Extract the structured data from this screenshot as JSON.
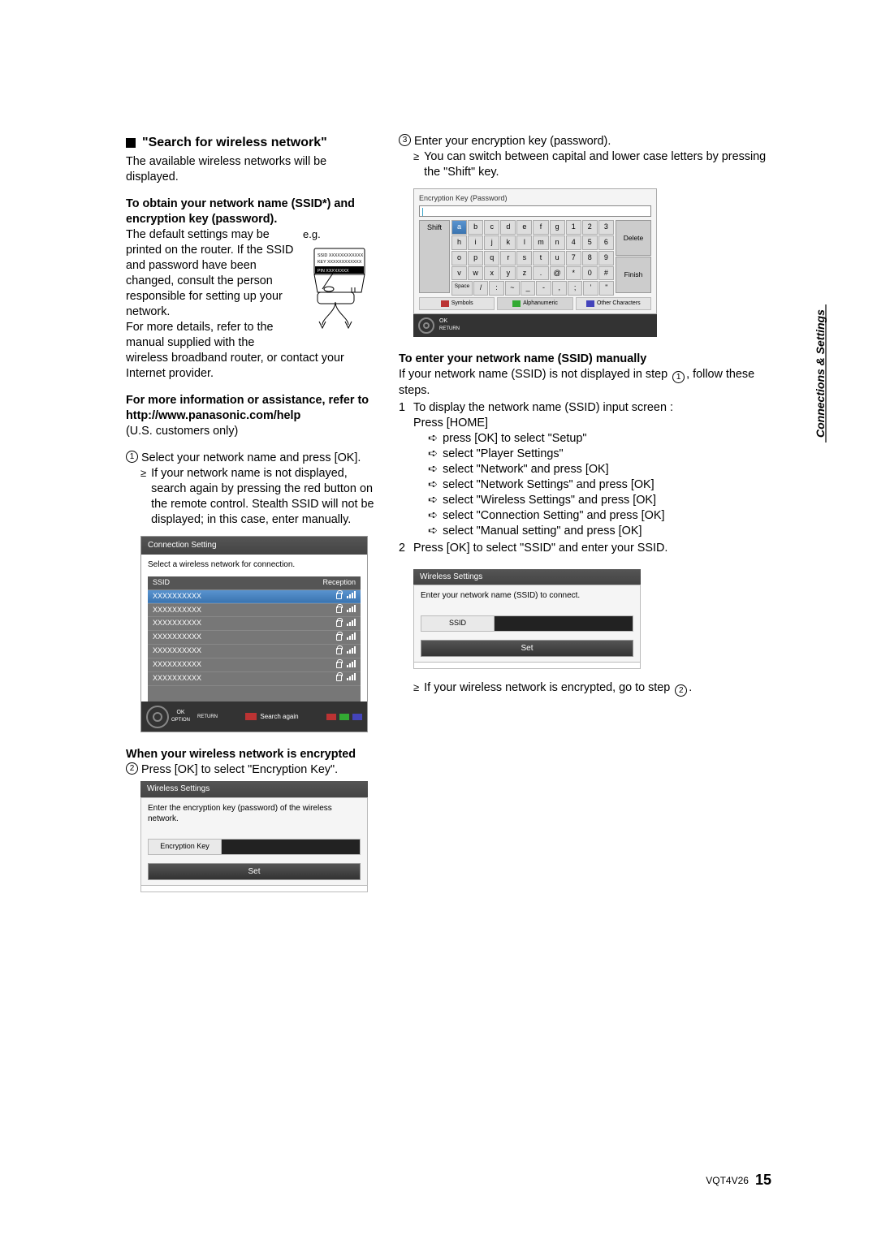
{
  "left": {
    "title": "\"Search for wireless network\"",
    "intro": "The available wireless networks will be displayed.",
    "obtainHdr": "To obtain your network name (SSID*) and encryption key (password).",
    "eg": "e.g.",
    "defaults": "The default settings may be printed on the router. If the SSID and password have been changed, consult the person responsible for setting up your network.",
    "moreDetails": "For more details, refer to the manual supplied with the wireless broadband router, or contact your Internet provider.",
    "moreInfo1": "For more information or assistance, refer to http://www.panasonic.com/help",
    "usOnly": "(U.S. customers only)",
    "step1": "Select your network name and press [OK].",
    "step1sub": "If your network name is not displayed, search again by pressing the red button on the remote control. Stealth SSID will not be displayed; in this case, enter manually.",
    "connSettingHdr": "Connection Setting",
    "connPrompt": "Select a wireless network for connection.",
    "ssidCol": "SSID",
    "recCol": "Reception",
    "ssidVal": "XXXXXXXXXX",
    "searchAgain": "Search again",
    "okLabel": "OK",
    "optionLabel": "OPTION",
    "returnLabel": "RETURN",
    "encryptHdr": "When your wireless network is encrypted",
    "step2": "Press [OK] to select \"Encryption Key\".",
    "wirelessHdr": "Wireless Settings",
    "enterKeyPrompt": "Enter the encryption key (password) of the wireless network.",
    "encKeyLabel": "Encryption Key",
    "setLabel": "Set"
  },
  "right": {
    "step3": "Enter your encryption key (password).",
    "step3sub": "You can switch between capital and lower case letters by pressing the \"Shift\" key.",
    "kbdTitle": "Encryption Key (Password)",
    "shift": "Shift",
    "del": "Delete",
    "finish": "Finish",
    "rows": [
      [
        "a",
        "b",
        "c",
        "d",
        "e",
        "f",
        "g",
        "1",
        "2",
        "3"
      ],
      [
        "h",
        "i",
        "j",
        "k",
        "l",
        "m",
        "n",
        "4",
        "5",
        "6"
      ],
      [
        "o",
        "p",
        "q",
        "r",
        "s",
        "t",
        "u",
        "7",
        "8",
        "9"
      ],
      [
        "v",
        "w",
        "x",
        "y",
        "z",
        ".",
        "@",
        "*",
        "0",
        "#"
      ]
    ],
    "specialRow": [
      "Space",
      "/",
      ":",
      "~",
      "_",
      "-",
      ",",
      ";",
      "’",
      "\""
    ],
    "tabSymbols": "Symbols",
    "tabAlpha": "Alphanumeric",
    "tabOther": "Other Characters",
    "okRet": "OK",
    "returnLabel": "RETURN",
    "manualHdr": "To enter your network name (SSID) manually",
    "manualIntro1": "If your network name (SSID) is not displayed in step ",
    "manualIntro2": ", follow these steps.",
    "m1": "To display the network name (SSID) input screen :",
    "pressHome": "Press [HOME]",
    "subs": [
      "press [OK] to select \"Setup\"",
      "select \"Player Settings\"",
      "select \"Network\" and press [OK]",
      "select \"Network Settings\" and press [OK]",
      "select \"Wireless Settings\" and press [OK]",
      "select \"Connection Setting\" and press [OK]",
      "select \"Manual setting\" and press [OK]"
    ],
    "m2": "Press [OK] to select \"SSID\" and enter your SSID.",
    "wirelessHdr": "Wireless Settings",
    "ssidPrompt": "Enter your network name (SSID) to connect.",
    "ssidLabel": "SSID",
    "setLabel": "Set",
    "encrNote1": "If your wireless network is encrypted, go to step ",
    "encrNote2": "."
  },
  "sideTab": "Connections & Settings",
  "footerCode": "VQT4V26",
  "pageNum": "15",
  "routerLabels": {
    "ssid": "SSID XXXXXXXXXXXX",
    "key": "KEY XXXXXXXXXXXX",
    "pin": "PIN XXXXXXXX"
  }
}
